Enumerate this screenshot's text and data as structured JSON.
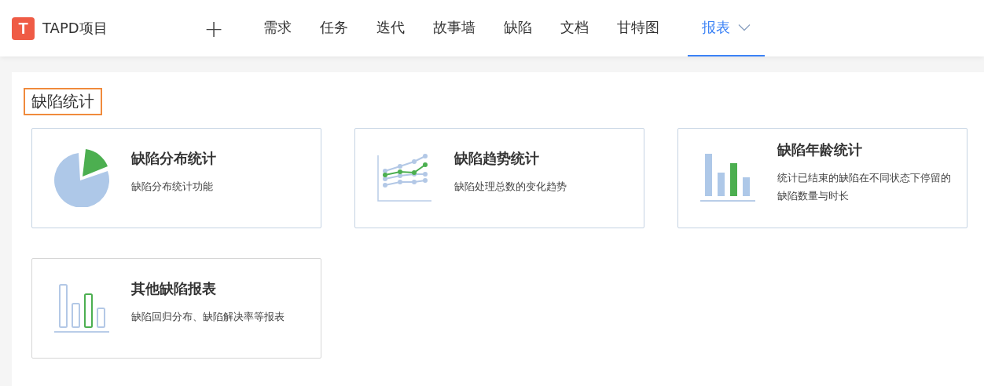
{
  "header": {
    "logo_letter": "T",
    "project": "TAPD项目",
    "add_icon": "+",
    "tabs": [
      {
        "label": "需求",
        "selected": false
      },
      {
        "label": "任务",
        "selected": false
      },
      {
        "label": "迭代",
        "selected": false
      },
      {
        "label": "故事墙",
        "selected": false
      },
      {
        "label": "缺陷",
        "selected": false
      },
      {
        "label": "文档",
        "selected": false
      },
      {
        "label": "甘特图",
        "selected": false
      },
      {
        "label": "报表",
        "selected": true,
        "dropdown": true
      }
    ]
  },
  "section": {
    "title": "缺陷统计",
    "cards": [
      {
        "kind": "pie",
        "title": "缺陷分布统计",
        "description": "缺陷分布统计功能"
      },
      {
        "kind": "line",
        "title": "缺陷趋势统计",
        "description": "缺陷处理总数的变化趋势"
      },
      {
        "kind": "bar",
        "title": "缺陷年龄统计",
        "description": "统计已结束的缺陷在不同状态下停留的缺陷数量与时长"
      },
      {
        "kind": "outline-bar",
        "title": "其他缺陷报表",
        "description": "缺陷回归分布、缺陷解决率等报表"
      }
    ]
  }
}
